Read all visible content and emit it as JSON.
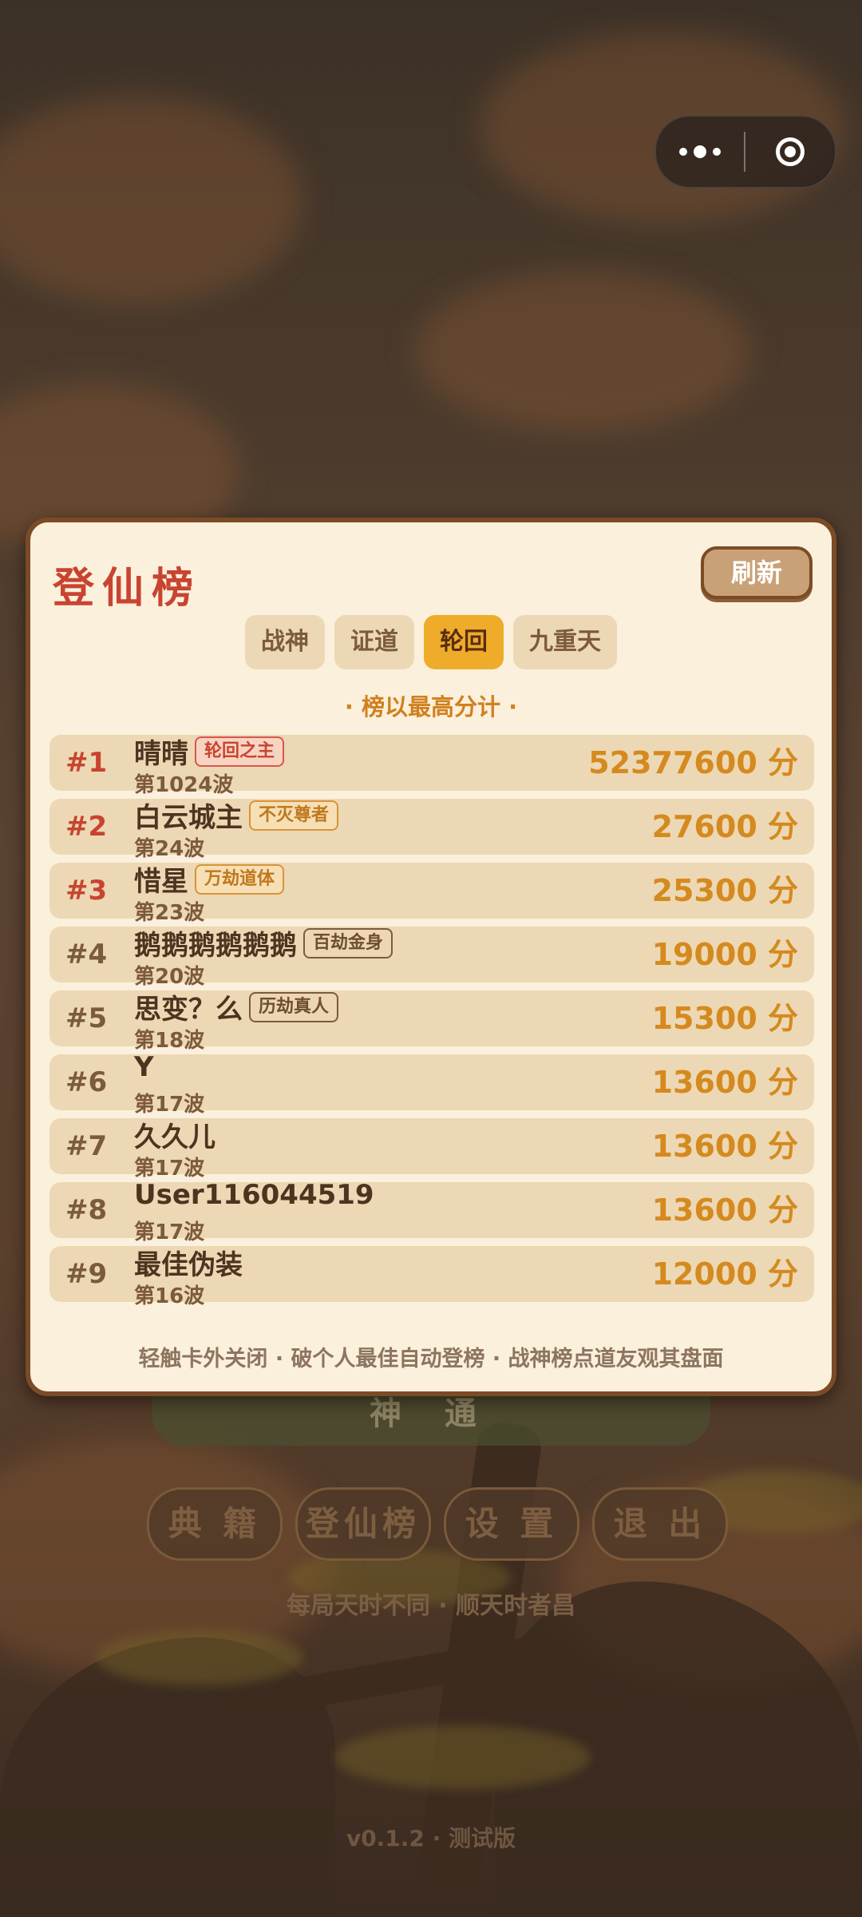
{
  "background": {
    "title_art": "",
    "big_button": "神 通",
    "buttons": [
      "典 籍",
      "登仙榜",
      "设 置",
      "退 出"
    ],
    "motto": "每局天时不同 · 顺天时者昌",
    "version": "v0.1.2 · 测试版"
  },
  "capsule": {
    "more_icon": "more-dots-icon",
    "close_icon": "target-close-icon"
  },
  "leaderboard": {
    "title": "登仙榜",
    "refresh_label": "刷新",
    "tabs": [
      {
        "label": "战神",
        "active": false
      },
      {
        "label": "证道",
        "active": false
      },
      {
        "label": "轮回",
        "active": true
      },
      {
        "label": "九重天",
        "active": false
      }
    ],
    "note": "· 榜以最高分计 ·",
    "entries": [
      {
        "rank": "#1",
        "name": "晴晴",
        "badge": "轮回之主",
        "badge_style": "red",
        "wave": "第1024波",
        "score": "52377600 分"
      },
      {
        "rank": "#2",
        "name": "白云城主",
        "badge": "不灭尊者",
        "badge_style": "gold",
        "wave": "第24波",
        "score": "27600 分"
      },
      {
        "rank": "#3",
        "name": "惜星",
        "badge": "万劫道体",
        "badge_style": "gold",
        "wave": "第23波",
        "score": "25300 分"
      },
      {
        "rank": "#4",
        "name": "鹅鹅鹅鹅鹅鹅",
        "badge": "百劫金身",
        "badge_style": "brown",
        "wave": "第20波",
        "score": "19000 分"
      },
      {
        "rank": "#5",
        "name": "思变？么",
        "badge": "历劫真人",
        "badge_style": "brown",
        "wave": "第18波",
        "score": "15300 分"
      },
      {
        "rank": "#6",
        "name": "Y",
        "badge": "",
        "badge_style": "",
        "wave": "第17波",
        "score": "13600 分"
      },
      {
        "rank": "#7",
        "name": "久久儿",
        "badge": "",
        "badge_style": "",
        "wave": "第17波",
        "score": "13600 分"
      },
      {
        "rank": "#8",
        "name": "User116044519",
        "badge": "",
        "badge_style": "",
        "wave": "第17波",
        "score": "13600 分"
      },
      {
        "rank": "#9",
        "name": "最佳伪装",
        "badge": "",
        "badge_style": "",
        "wave": "第16波",
        "score": "12000 分"
      }
    ],
    "footer_tip": "轻触卡外关闭 · 破个人最佳自动登榜 · 战神榜点道友观其盘面"
  }
}
